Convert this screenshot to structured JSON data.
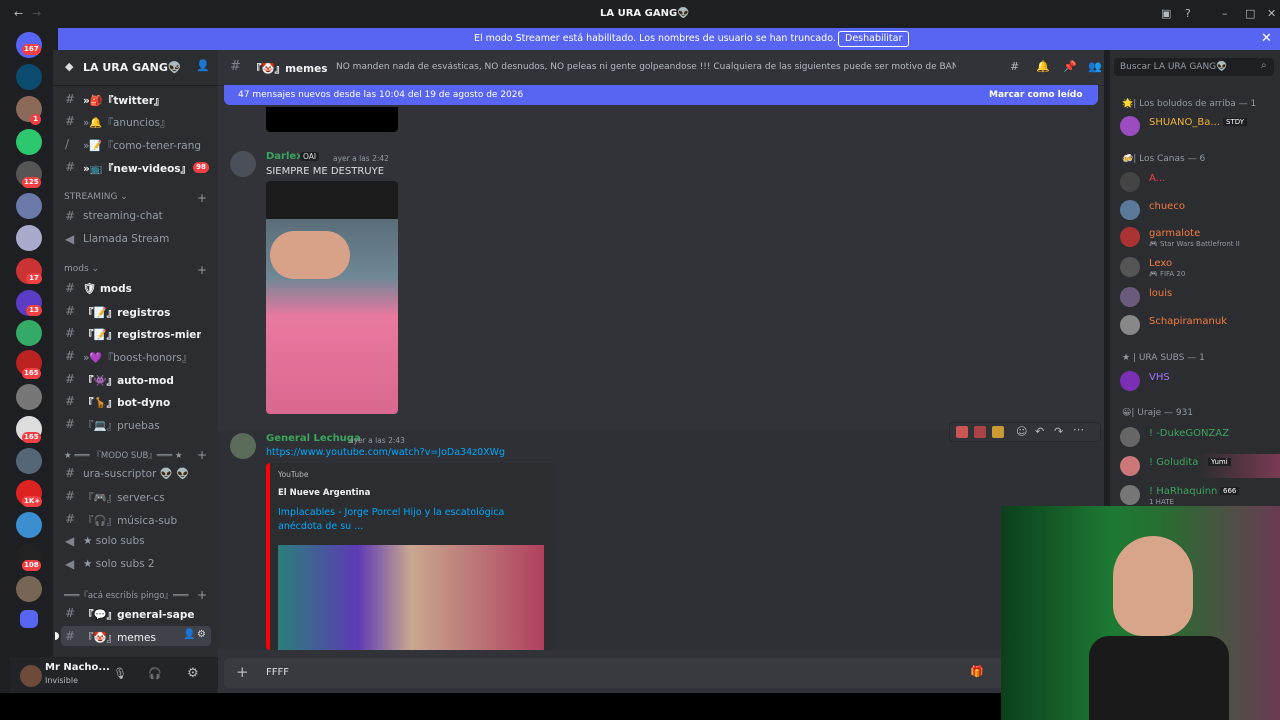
{
  "window": {
    "title": "LA URA GANG👽"
  },
  "banner": {
    "text": "El modo Streamer está habilitado. Los nombres de usuario se han truncado.",
    "button": "Deshabilitar"
  },
  "guilds": {
    "badges": [
      "167",
      "1",
      "125",
      "17",
      "13",
      "165",
      "165",
      "1K+",
      "108"
    ]
  },
  "server": {
    "name": "LA URA GANG👽"
  },
  "channels": [
    {
      "name": "»🎒『twitter』",
      "unread": true
    },
    {
      "name": "»🔔『anuncios』",
      "unread": false
    },
    {
      "name": "»📝『como-tener-rang...",
      "unread": false
    },
    {
      "name": "»📺『new-videos』",
      "unread": true,
      "badge": "98"
    }
  ],
  "cat_streaming": "STREAMING",
  "streaming": [
    {
      "name": "streaming-chat"
    },
    {
      "name": "Llamada Stream"
    }
  ],
  "cat_mods": "mods",
  "mods": [
    {
      "name": "🛡 mods",
      "unread": true
    },
    {
      "name": "『📝』registros",
      "unread": true
    },
    {
      "name": "『📝』registros-miem...",
      "unread": true
    },
    {
      "name": "»💜『boost-honors』",
      "unread": false
    },
    {
      "name": "『👾』auto-mod",
      "unread": true
    },
    {
      "name": "『🦒』bot-dyno",
      "unread": true
    },
    {
      "name": "『💻』pruebas",
      "unread": false
    }
  ],
  "cat_subs": "★ ═══ 『MODO SUB』═══ ★",
  "subs": [
    {
      "name": "ura-suscriptor 👽 👽"
    },
    {
      "name": "『🎮』server-cs"
    },
    {
      "name": "『🎧』música-sub"
    },
    {
      "name": "★ solo subs"
    },
    {
      "name": "★ solo subs 2"
    }
  ],
  "cat_aca": "═══『acá escribís pingo』═══",
  "aca": [
    {
      "name": "『💬』general-sape",
      "unread": true
    },
    {
      "name": "『🤡』memes",
      "selected": true
    }
  ],
  "user": {
    "name": "Mr Nacho...",
    "status": "Invisible"
  },
  "chat": {
    "channel": "『🤡』memes",
    "topic": "NO manden nada de esvásticas, NO desnudos, NO peleas ni gente golpeandose !!! Cualquiera de las siguientes puede ser motivo de BAN, cuiden el stream!",
    "search_placeholder": "Buscar LA URA GANG👽",
    "new_messages": "47 mensajes nuevos desde las 10:04 del 19 de agosto de 2026",
    "mark_read": "Marcar como leído",
    "messages": [
      {
        "user": "Darlex",
        "tag": "OAI",
        "time": "ayer a las 2:42",
        "text": "SIEMPRE ME DESTRUYE"
      },
      {
        "user": "General Lechuga",
        "time": "ayer a las 2:43",
        "link": "https://www.youtube.com/watch?v=JoDa34z0XWg",
        "embed": {
          "provider": "YouTube",
          "author": "El Nueve Argentina",
          "title": "Implacables - Jorge Porcel Hijo y la escatológica anécdota de su ..."
        }
      }
    ],
    "composer_text": "FFFF"
  },
  "members": {
    "groups": [
      {
        "label": "🌟| Los boludos de arriba — 1"
      },
      {
        "label": "🍻| Los Canas — 6"
      },
      {
        "label": "★ | URA SUBS — 1"
      },
      {
        "label": "😀| Uraje — 931"
      }
    ],
    "list": [
      {
        "name": "SHUANO_Ba...",
        "tag": "STDY",
        "color": "#f0b232"
      },
      {
        "name": "A...",
        "color": "#ed4245"
      },
      {
        "name": "chueco",
        "color": "#f47b3f"
      },
      {
        "name": "garmalote",
        "activity": "🎮 Star Wars Battlefront II",
        "color": "#f47b3f"
      },
      {
        "name": "Lexo",
        "activity": "🎮 FIFA 20",
        "color": "#f47b3f"
      },
      {
        "name": "louis",
        "color": "#f47b3f"
      },
      {
        "name": "Schapiramanuk",
        "color": "#f47b3f"
      },
      {
        "name": "VHS",
        "color": "#a970ff"
      },
      {
        "name": "! -DukeGONZAZ",
        "color": "#3ba55d"
      },
      {
        "name": "! Goludita",
        "tag": "Yumi",
        "color": "#3ba55d"
      },
      {
        "name": "! HaRhaquinn",
        "tag": "666",
        "activity": "1 HATE",
        "color": "#3ba55d"
      }
    ]
  },
  "colors": {
    "accent": "#5865f2",
    "bg": "#313338",
    "sidebar": "#2b2d31"
  }
}
